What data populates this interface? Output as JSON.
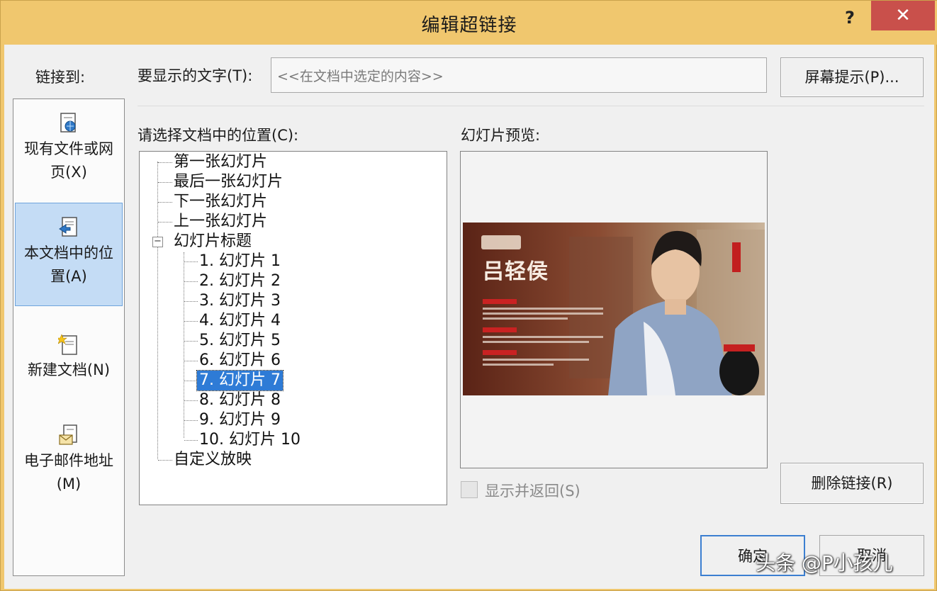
{
  "window": {
    "title": "编辑超链接",
    "help_label": "?",
    "close_label": "✕"
  },
  "link_to": {
    "label": "链接到:",
    "items": [
      {
        "label": "现有文件或网页(X)",
        "icon": "web-file-icon"
      },
      {
        "label": "本文档中的位置(A)",
        "icon": "document-place-icon",
        "selected": true
      },
      {
        "label": "新建文档(N)",
        "icon": "new-document-icon"
      },
      {
        "label": "电子邮件地址(M)",
        "icon": "email-icon"
      }
    ],
    "lines": {
      "item0": [
        "现有文件或网",
        "页(X)"
      ],
      "item1": [
        "本文档中的位",
        "置(A)"
      ],
      "item2": [
        "新建文档(N)"
      ],
      "item3": [
        "电子邮件地址",
        "(M)"
      ]
    }
  },
  "display_text": {
    "label": "要显示的文字(T):",
    "value": "<<在文档中选定的内容>>"
  },
  "screentip_button": "屏幕提示(P)...",
  "location": {
    "label": "请选择文档中的位置(C):",
    "nodes": {
      "first": "第一张幻灯片",
      "last": "最后一张幻灯片",
      "next": "下一张幻灯片",
      "prev": "上一张幻灯片",
      "titles": "幻灯片标题",
      "custom": "自定义放映"
    },
    "slides": [
      "1. 幻灯片 1",
      "2. 幻灯片 2",
      "3. 幻灯片 3",
      "4. 幻灯片 4",
      "5. 幻灯片 5",
      "6. 幻灯片 6",
      "7. 幻灯片 7",
      "8. 幻灯片 8",
      "9. 幻灯片 9",
      "10. 幻灯片 10"
    ],
    "selected_slide": "7. 幻灯片 7",
    "expander_symbol": "−"
  },
  "preview": {
    "label": "幻灯片预览:",
    "slide_title": "吕轻侯"
  },
  "show_and_return": {
    "label": "显示并返回(S)",
    "checked": false,
    "enabled": false
  },
  "remove_link_button": "删除链接(R)",
  "ok_button": "确定",
  "cancel_button": "取消",
  "watermark": "头条 @P小孩儿",
  "colors": {
    "titlebar": "#f0c76e",
    "close_button": "#c9504b",
    "selection": "#2e7bd6",
    "panel_selected": "#c4dcf5"
  }
}
